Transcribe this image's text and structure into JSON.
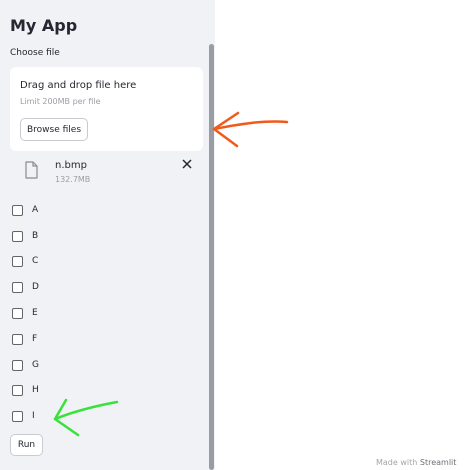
{
  "sidebar": {
    "title": "My App",
    "uploader": {
      "label": "Choose file",
      "drop_text": "Drag and drop file here",
      "limit_text": "Limit 200MB per file",
      "browse_label": "Browse files",
      "file": {
        "name": "n.bmp",
        "size": "132.7MB",
        "icon": "file-icon",
        "remove_icon": "close-icon"
      }
    },
    "checkboxes": [
      {
        "label": "A",
        "checked": false
      },
      {
        "label": "B",
        "checked": false
      },
      {
        "label": "C",
        "checked": false
      },
      {
        "label": "D",
        "checked": false
      },
      {
        "label": "E",
        "checked": false
      },
      {
        "label": "F",
        "checked": false
      },
      {
        "label": "G",
        "checked": false
      },
      {
        "label": "H",
        "checked": false
      },
      {
        "label": "I",
        "checked": false
      }
    ],
    "run_label": "Run"
  },
  "footer": {
    "prefix": "Made with",
    "brand": "Streamlit"
  },
  "annotations": [
    {
      "color": "#f05a1a",
      "points_to": "file uploader"
    },
    {
      "color": "#39e23a",
      "points_to": "checkbox I"
    }
  ]
}
